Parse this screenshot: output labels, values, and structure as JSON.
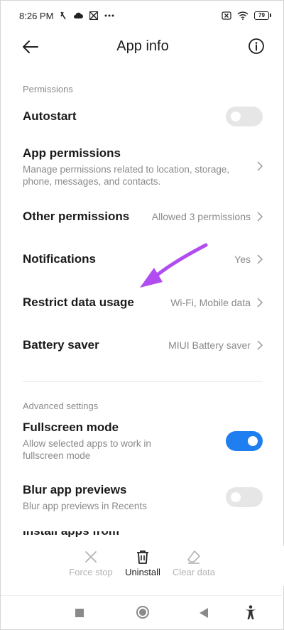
{
  "status_bar": {
    "time": "8:26 PM",
    "battery": "79"
  },
  "header": {
    "title": "App info"
  },
  "sections": {
    "permissions": "Permissions",
    "advanced": "Advanced settings"
  },
  "rows": {
    "autostart": {
      "title": "Autostart",
      "enabled": false
    },
    "app_permissions": {
      "title": "App permissions",
      "subtitle": "Manage permissions related to location, storage, phone, messages, and contacts."
    },
    "other_permissions": {
      "title": "Other permissions",
      "value": "Allowed 3 permissions"
    },
    "notifications": {
      "title": "Notifications",
      "value": "Yes"
    },
    "restrict_data": {
      "title": "Restrict data usage",
      "value": "Wi-Fi, Mobile data"
    },
    "battery_saver": {
      "title": "Battery saver",
      "value": "MIUI Battery saver"
    },
    "fullscreen": {
      "title": "Fullscreen mode",
      "subtitle": "Allow selected apps to work in fullscreen mode",
      "enabled": true
    },
    "blur_previews": {
      "title": "Blur app previews",
      "subtitle": "Blur app previews in Recents",
      "enabled": false
    },
    "partial_next": {
      "title": "Install apps from unknown sources"
    }
  },
  "actions": {
    "force_stop": "Force stop",
    "uninstall": "Uninstall",
    "clear_data": "Clear data"
  },
  "colors": {
    "accent": "#1f7ff0",
    "annotation_arrow": "#b04cf0",
    "secondary_text": "#8a8a8a"
  },
  "icons": {
    "back": "arrow-left-icon",
    "info": "info-icon",
    "force_stop": "close-x-icon",
    "uninstall": "trash-icon",
    "clear_data": "eraser-icon",
    "nav_recents": "square-icon",
    "nav_home": "circle-icon",
    "nav_back": "triangle-icon",
    "accessibility": "accessibility-icon"
  }
}
